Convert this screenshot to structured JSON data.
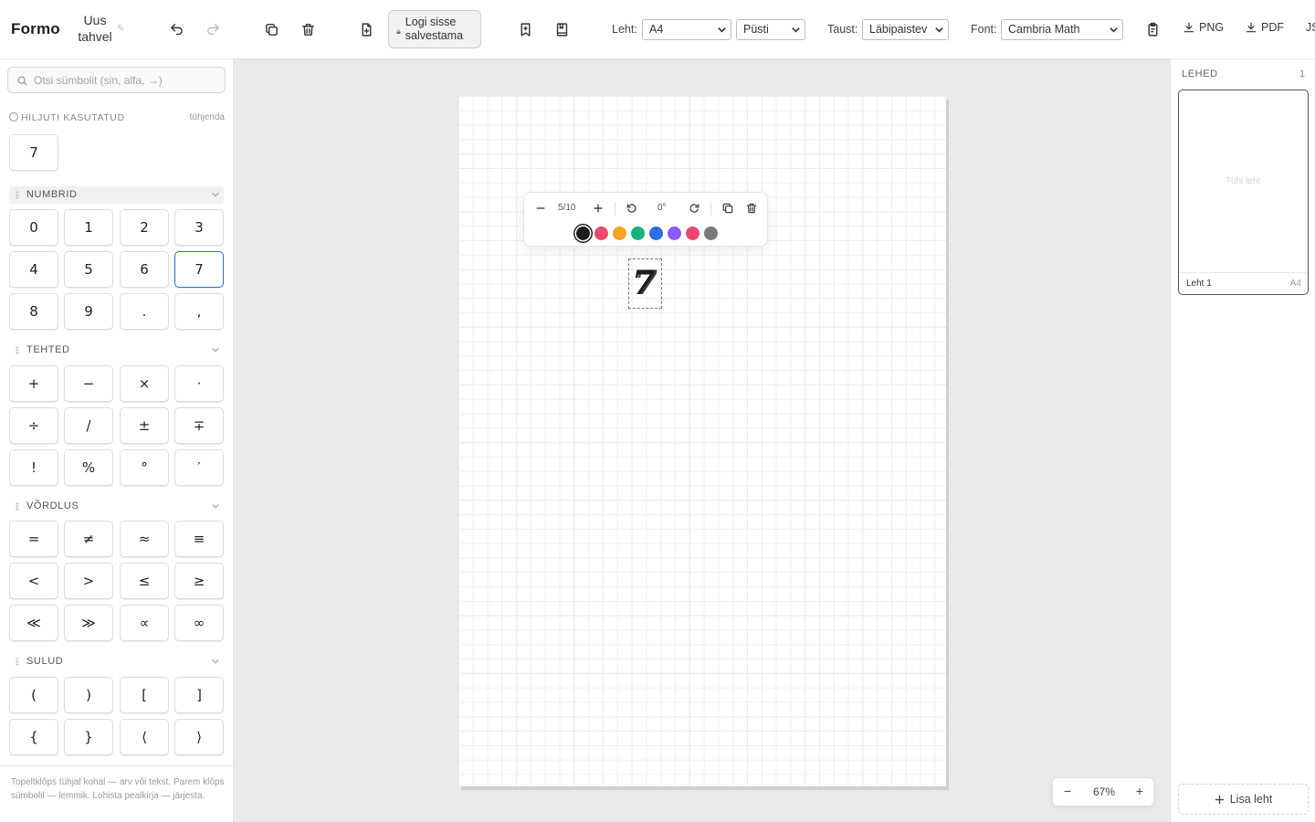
{
  "app": {
    "name": "Formo",
    "doc_title": "Uus tahvel"
  },
  "toolbar": {
    "login_label": "Logi sisse salvestama",
    "page_label": "Leht:",
    "page_size": "A4",
    "orientation": "Püsti",
    "background_label": "Taust:",
    "background": "Läbipaistev",
    "font_label": "Font:",
    "font": "Cambria Math",
    "png_label": "PNG",
    "pdf_label": "PDF",
    "js_label": "JS"
  },
  "palette": {
    "search_placeholder": "Otsi sümbolit (sin, alfa, →)",
    "recent": {
      "title": "HILJUTI KASUTATUD",
      "clear_label": "tühjenda",
      "items": [
        "7"
      ]
    },
    "numbers": {
      "title": "NUMBRID",
      "keys": [
        "0",
        "1",
        "2",
        "3",
        "4",
        "5",
        "6",
        "7",
        "8",
        "9",
        ".",
        ","
      ],
      "selected": "7"
    },
    "operations": {
      "title": "TEHTED",
      "keys": [
        "+",
        "−",
        "×",
        "·",
        "÷",
        "/",
        "±",
        "∓",
        "!",
        "%",
        "°",
        "′"
      ]
    },
    "comparison": {
      "title": "VÕRDLUS",
      "keys": [
        "=",
        "≠",
        "≈",
        "≡",
        "<",
        ">",
        "≤",
        "≥",
        "≪",
        "≫",
        "∝",
        "∞"
      ]
    },
    "brackets": {
      "title": "SULUD",
      "keys": [
        "(",
        ")",
        "[",
        "]",
        "{",
        "}",
        "⟨",
        "⟩"
      ]
    },
    "hint": "Topeltklõps tühjal kohal — arv või tekst. Parem klõps sümbolil — lemmik. Lohista pealkirja — järjesta."
  },
  "canvas": {
    "symbol": "7",
    "float_toolbar": {
      "size_value": "5/10",
      "rotation_value": "0°",
      "colors": [
        "#1c1c1c",
        "#e84a6f",
        "#f5a524",
        "#1bb07a",
        "#2f6fdf",
        "#8b5cf6",
        "#e84a6f",
        "#7a7a7a"
      ],
      "active_color": "#1c1c1c"
    },
    "zoom": {
      "value": "67%",
      "minus": "−",
      "plus": "+"
    }
  },
  "pages": {
    "title": "LEHED",
    "count": "1",
    "items": [
      {
        "name": "Leht 1",
        "size": "A4",
        "empty_label": "Tühi leht"
      }
    ],
    "add_label": "Lisa leht"
  }
}
